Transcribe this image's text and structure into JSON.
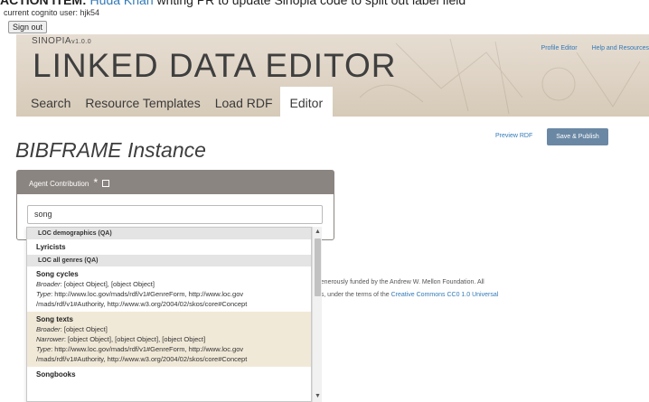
{
  "banner": {
    "lead": "ACTION ITEM:",
    "person": "Huda Khan",
    "text": "writing PR to update Sinopia code to split out label field"
  },
  "session": {
    "cognito_user_text": "current cognito user: hjk54",
    "sign_out_label": "Sign out"
  },
  "header": {
    "brand": "SINOPIA",
    "version": "v1.0.0",
    "title": "LINKED DATA EDITOR",
    "links": [
      "Profile Editor",
      "Help and Resources"
    ],
    "tabs": [
      {
        "label": "Search",
        "active": false
      },
      {
        "label": "Resource Templates",
        "active": false
      },
      {
        "label": "Load RDF",
        "active": false
      },
      {
        "label": "Editor",
        "active": true
      }
    ]
  },
  "editor": {
    "page_title": "BIBFRAME Instance",
    "preview_label": "Preview RDF",
    "publish_label": "Save & Publish",
    "panel_title": "Agent Contribution",
    "panel_required_mark": "*",
    "search_value": "song"
  },
  "footer": {
    "line1": ", generously funded by the Andrew W. Mellon Foundation. All",
    "line2_prefix": "ons, under the terms of the ",
    "line2_link": "Creative Commons CC0 1.0 Universal"
  },
  "dropdown": {
    "groups": [
      {
        "header": "LOC demographics (QA)",
        "simple_items": [
          "Lyricists"
        ]
      },
      {
        "header": "LOC all genres (QA)"
      }
    ],
    "items": [
      {
        "name": "Song cycles",
        "broader_label": "Broader",
        "broader": "[object Object], [object Object]",
        "type_label": "Type",
        "type_line1": "http://www.loc.gov/mads/rdf/v1#GenreForm, http://www.loc.gov",
        "type_line2": "/mads/rdf/v1#Authority, http://www.w3.org/2004/02/skos/core#Concept",
        "highlight": false
      },
      {
        "name": "Song texts",
        "broader_label": "Broader",
        "broader": "[object Object]",
        "narrower_label": "Narrower",
        "narrower": "[object Object], [object Object], [object Object]",
        "type_label": "Type",
        "type_line1": "http://www.loc.gov/mads/rdf/v1#GenreForm, http://www.loc.gov",
        "type_line2": "/mads/rdf/v1#Authority, http://www.w3.org/2004/02/skos/core#Concept",
        "highlight": true
      },
      {
        "name": "Songbooks"
      }
    ]
  },
  "colors": {
    "link": "#337ab7",
    "panel_header": "#8b8581",
    "publish_button": "#6a88a4",
    "highlight_row": "#f1e9d8"
  }
}
